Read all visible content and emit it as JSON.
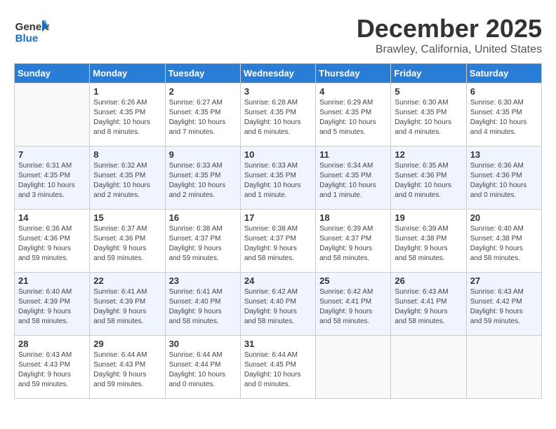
{
  "header": {
    "logo_general": "General",
    "logo_blue": "Blue",
    "month": "December 2025",
    "location": "Brawley, California, United States"
  },
  "days_of_week": [
    "Sunday",
    "Monday",
    "Tuesday",
    "Wednesday",
    "Thursday",
    "Friday",
    "Saturday"
  ],
  "weeks": [
    [
      {
        "day": "",
        "info": ""
      },
      {
        "day": "1",
        "info": "Sunrise: 6:26 AM\nSunset: 4:35 PM\nDaylight: 10 hours\nand 8 minutes."
      },
      {
        "day": "2",
        "info": "Sunrise: 6:27 AM\nSunset: 4:35 PM\nDaylight: 10 hours\nand 7 minutes."
      },
      {
        "day": "3",
        "info": "Sunrise: 6:28 AM\nSunset: 4:35 PM\nDaylight: 10 hours\nand 6 minutes."
      },
      {
        "day": "4",
        "info": "Sunrise: 6:29 AM\nSunset: 4:35 PM\nDaylight: 10 hours\nand 5 minutes."
      },
      {
        "day": "5",
        "info": "Sunrise: 6:30 AM\nSunset: 4:35 PM\nDaylight: 10 hours\nand 4 minutes."
      },
      {
        "day": "6",
        "info": "Sunrise: 6:30 AM\nSunset: 4:35 PM\nDaylight: 10 hours\nand 4 minutes."
      }
    ],
    [
      {
        "day": "7",
        "info": "Sunrise: 6:31 AM\nSunset: 4:35 PM\nDaylight: 10 hours\nand 3 minutes."
      },
      {
        "day": "8",
        "info": "Sunrise: 6:32 AM\nSunset: 4:35 PM\nDaylight: 10 hours\nand 2 minutes."
      },
      {
        "day": "9",
        "info": "Sunrise: 6:33 AM\nSunset: 4:35 PM\nDaylight: 10 hours\nand 2 minutes."
      },
      {
        "day": "10",
        "info": "Sunrise: 6:33 AM\nSunset: 4:35 PM\nDaylight: 10 hours\nand 1 minute."
      },
      {
        "day": "11",
        "info": "Sunrise: 6:34 AM\nSunset: 4:35 PM\nDaylight: 10 hours\nand 1 minute."
      },
      {
        "day": "12",
        "info": "Sunrise: 6:35 AM\nSunset: 4:36 PM\nDaylight: 10 hours\nand 0 minutes."
      },
      {
        "day": "13",
        "info": "Sunrise: 6:36 AM\nSunset: 4:36 PM\nDaylight: 10 hours\nand 0 minutes."
      }
    ],
    [
      {
        "day": "14",
        "info": "Sunrise: 6:36 AM\nSunset: 4:36 PM\nDaylight: 9 hours\nand 59 minutes."
      },
      {
        "day": "15",
        "info": "Sunrise: 6:37 AM\nSunset: 4:36 PM\nDaylight: 9 hours\nand 59 minutes."
      },
      {
        "day": "16",
        "info": "Sunrise: 6:38 AM\nSunset: 4:37 PM\nDaylight: 9 hours\nand 59 minutes."
      },
      {
        "day": "17",
        "info": "Sunrise: 6:38 AM\nSunset: 4:37 PM\nDaylight: 9 hours\nand 58 minutes."
      },
      {
        "day": "18",
        "info": "Sunrise: 6:39 AM\nSunset: 4:37 PM\nDaylight: 9 hours\nand 58 minutes."
      },
      {
        "day": "19",
        "info": "Sunrise: 6:39 AM\nSunset: 4:38 PM\nDaylight: 9 hours\nand 58 minutes."
      },
      {
        "day": "20",
        "info": "Sunrise: 6:40 AM\nSunset: 4:38 PM\nDaylight: 9 hours\nand 58 minutes."
      }
    ],
    [
      {
        "day": "21",
        "info": "Sunrise: 6:40 AM\nSunset: 4:39 PM\nDaylight: 9 hours\nand 58 minutes."
      },
      {
        "day": "22",
        "info": "Sunrise: 6:41 AM\nSunset: 4:39 PM\nDaylight: 9 hours\nand 58 minutes."
      },
      {
        "day": "23",
        "info": "Sunrise: 6:41 AM\nSunset: 4:40 PM\nDaylight: 9 hours\nand 58 minutes."
      },
      {
        "day": "24",
        "info": "Sunrise: 6:42 AM\nSunset: 4:40 PM\nDaylight: 9 hours\nand 58 minutes."
      },
      {
        "day": "25",
        "info": "Sunrise: 6:42 AM\nSunset: 4:41 PM\nDaylight: 9 hours\nand 58 minutes."
      },
      {
        "day": "26",
        "info": "Sunrise: 6:43 AM\nSunset: 4:41 PM\nDaylight: 9 hours\nand 58 minutes."
      },
      {
        "day": "27",
        "info": "Sunrise: 6:43 AM\nSunset: 4:42 PM\nDaylight: 9 hours\nand 59 minutes."
      }
    ],
    [
      {
        "day": "28",
        "info": "Sunrise: 6:43 AM\nSunset: 4:43 PM\nDaylight: 9 hours\nand 59 minutes."
      },
      {
        "day": "29",
        "info": "Sunrise: 6:44 AM\nSunset: 4:43 PM\nDaylight: 9 hours\nand 59 minutes."
      },
      {
        "day": "30",
        "info": "Sunrise: 6:44 AM\nSunset: 4:44 PM\nDaylight: 10 hours\nand 0 minutes."
      },
      {
        "day": "31",
        "info": "Sunrise: 6:44 AM\nSunset: 4:45 PM\nDaylight: 10 hours\nand 0 minutes."
      },
      {
        "day": "",
        "info": ""
      },
      {
        "day": "",
        "info": ""
      },
      {
        "day": "",
        "info": ""
      }
    ]
  ]
}
